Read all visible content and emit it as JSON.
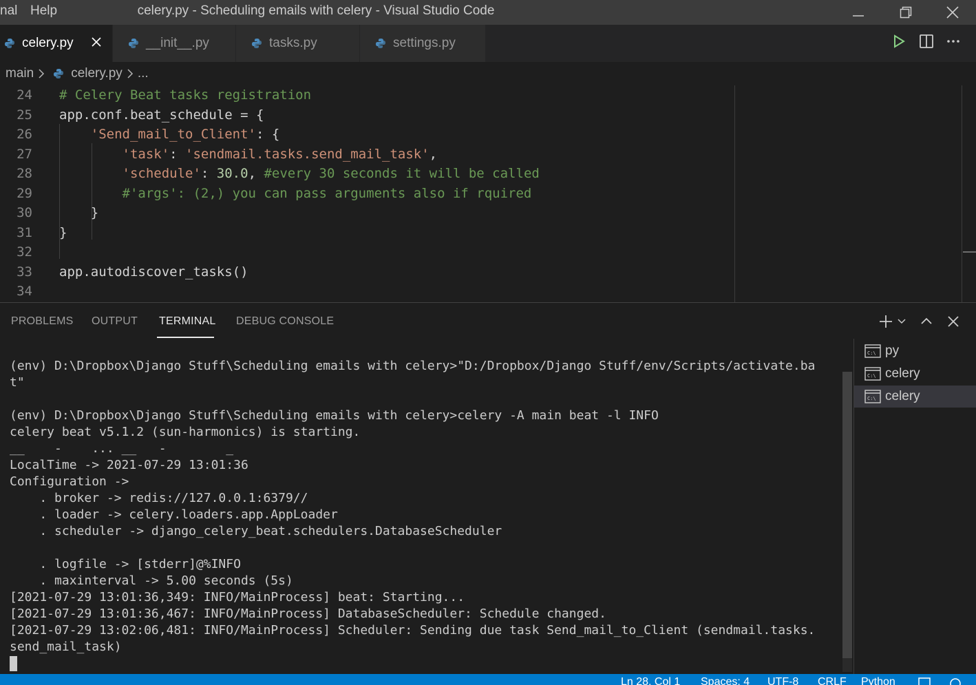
{
  "titlebar": {
    "menu": [
      "nal",
      "Help"
    ],
    "title": "celery.py - Scheduling emails with celery - Visual Studio Code"
  },
  "tabs": [
    {
      "label": "celery.py",
      "active": true
    },
    {
      "label": "__init__.py",
      "active": false
    },
    {
      "label": "tasks.py",
      "active": false
    },
    {
      "label": "settings.py",
      "active": false
    }
  ],
  "breadcrumb": {
    "folder": "main",
    "file": "celery.py",
    "more": "..."
  },
  "editor": {
    "lines": [
      {
        "num": "24",
        "parts": [
          [
            "c-com",
            "# Celery Beat tasks registration"
          ]
        ]
      },
      {
        "num": "25",
        "parts": [
          [
            "c-def",
            "app.conf.beat_schedule = {"
          ]
        ]
      },
      {
        "num": "26",
        "parts": [
          [
            "c-def",
            "    "
          ],
          [
            "c-str",
            "'Send_mail_to_Client'"
          ],
          [
            "c-def",
            ": {"
          ]
        ]
      },
      {
        "num": "27",
        "parts": [
          [
            "c-def",
            "        "
          ],
          [
            "c-str",
            "'task'"
          ],
          [
            "c-def",
            ": "
          ],
          [
            "c-str",
            "'sendmail.tasks.send_mail_task'"
          ],
          [
            "c-def",
            ","
          ]
        ]
      },
      {
        "num": "28",
        "parts": [
          [
            "c-def",
            "        "
          ],
          [
            "c-str",
            "'schedule'"
          ],
          [
            "c-def",
            ": "
          ],
          [
            "c-num",
            "30.0"
          ],
          [
            "c-def",
            ", "
          ],
          [
            "c-com",
            "#every 30 seconds it will be called"
          ]
        ]
      },
      {
        "num": "29",
        "parts": [
          [
            "c-def",
            "        "
          ],
          [
            "c-com",
            "#'args': (2,) you can pass arguments also if rquired"
          ]
        ]
      },
      {
        "num": "30",
        "parts": [
          [
            "c-def",
            "    }"
          ]
        ]
      },
      {
        "num": "31",
        "parts": [
          [
            "c-def",
            "}"
          ]
        ]
      },
      {
        "num": "32",
        "parts": []
      },
      {
        "num": "33",
        "parts": [
          [
            "c-def",
            "app.autodiscover_tasks()"
          ]
        ]
      },
      {
        "num": "34",
        "parts": []
      }
    ]
  },
  "panel": {
    "tabs": [
      "PROBLEMS",
      "OUTPUT",
      "TERMINAL",
      "DEBUG CONSOLE"
    ],
    "active_tab": "TERMINAL"
  },
  "terminal": {
    "lines": [
      "(env) D:\\Dropbox\\Django Stuff\\Scheduling emails with celery>\"D:/Dropbox/Django Stuff/env/Scripts/activate.ba",
      "t\"",
      "",
      "(env) D:\\Dropbox\\Django Stuff\\Scheduling emails with celery>celery -A main beat -l INFO",
      "celery beat v5.1.2 (sun-harmonics) is starting.",
      "__    -    ... __   -        _",
      "LocalTime -> 2021-07-29 13:01:36",
      "Configuration ->",
      "    . broker -> redis://127.0.0.1:6379//",
      "    . loader -> celery.loaders.app.AppLoader",
      "    . scheduler -> django_celery_beat.schedulers.DatabaseScheduler",
      "",
      "    . logfile -> [stderr]@%INFO",
      "    . maxinterval -> 5.00 seconds (5s)",
      "[2021-07-29 13:01:36,349: INFO/MainProcess] beat: Starting...",
      "[2021-07-29 13:01:36,467: INFO/MainProcess] DatabaseScheduler: Schedule changed.",
      "[2021-07-29 13:02:06,481: INFO/MainProcess] Scheduler: Sending due task Send_mail_to_Client (sendmail.tasks.",
      "send_mail_task)"
    ],
    "instances": [
      {
        "label": "py",
        "selected": false
      },
      {
        "label": "celery",
        "selected": false
      },
      {
        "label": "celery",
        "selected": true
      }
    ]
  },
  "statusbar": {
    "position": "Ln 28, Col 1",
    "spaces": "Spaces: 4",
    "encoding": "UTF-8",
    "eol": "CRLF",
    "language": "Python"
  },
  "colors": {
    "accent": "#007acc",
    "comment": "#6a9955",
    "string": "#ce9178",
    "number": "#b5cea8"
  }
}
